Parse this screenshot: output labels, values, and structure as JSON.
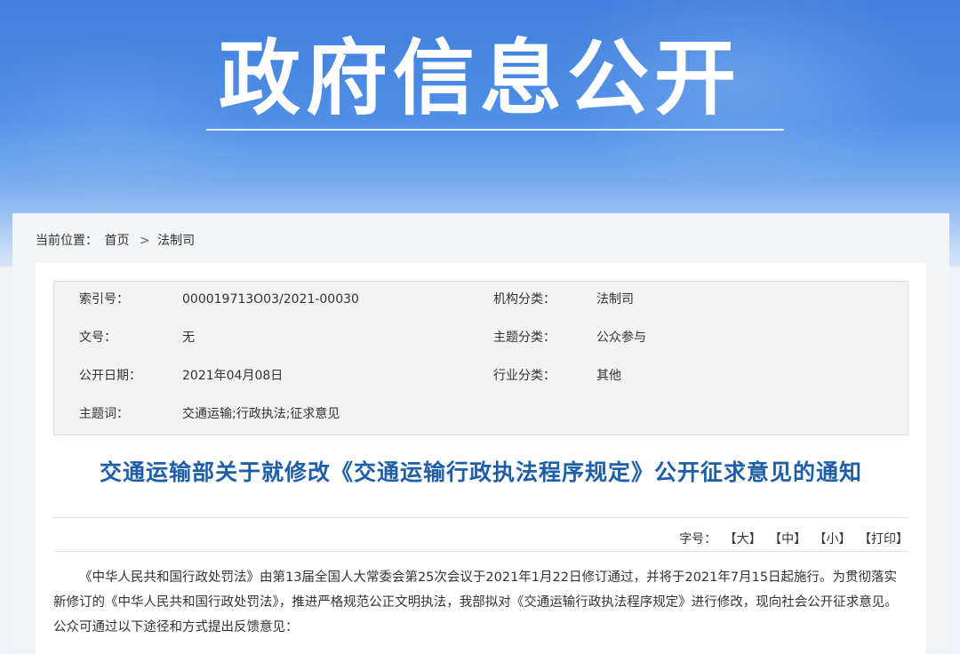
{
  "banner": {
    "title": "政府信息公开"
  },
  "breadcrumb": {
    "label": "当前位置：",
    "items": [
      "首页",
      "法制司"
    ],
    "separator": ">"
  },
  "meta": {
    "rows": [
      {
        "l1": "索引号：",
        "v1": "000019713O03/2021-00030",
        "l2": "机构分类：",
        "v2": "法制司"
      },
      {
        "l1": "文号：",
        "v1": "无",
        "l2": "主题分类：",
        "v2": "公众参与"
      },
      {
        "l1": "公开日期：",
        "v1": "2021年04月08日",
        "l2": "行业分类：",
        "v2": "其他"
      },
      {
        "l1": "主题词：",
        "v1": "交通运输;行政执法;征求意见",
        "l2": "",
        "v2": ""
      }
    ]
  },
  "article": {
    "title": "交通运输部关于就修改《交通运输行政执法程序规定》公开征求意见的通知",
    "body": "《中华人民共和国行政处罚法》由第13届全国人大常委会第25次会议于2021年1月22日修订通过，并将于2021年7月15日起施行。为贯彻落实新修订的《中华人民共和国行政处罚法》，推进严格规范公正文明执法，我部拟对《交通运输行政执法程序规定》进行修改，现向社会公开征求意见。公众可通过以下途径和方式提出反馈意见："
  },
  "fontsize": {
    "label": "字号：",
    "large": "【大】",
    "medium": "【中】",
    "small": "【小】",
    "print": "【打印】"
  },
  "colors": {
    "banner_blue": "#3f7fde",
    "title_blue": "#1f5fa8"
  }
}
